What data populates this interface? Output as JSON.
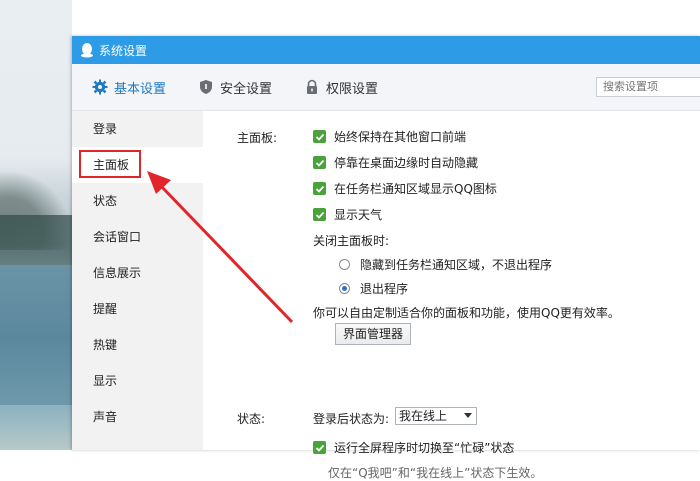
{
  "window": {
    "title": "系统设置"
  },
  "tabs": [
    {
      "label": "基本设置",
      "icon": "gear-icon"
    },
    {
      "label": "安全设置",
      "icon": "shield-icon"
    },
    {
      "label": "权限设置",
      "icon": "lock-icon"
    }
  ],
  "search": {
    "placeholder": "搜索设置项"
  },
  "sidebar": {
    "items": [
      {
        "label": "登录"
      },
      {
        "label": "主面板"
      },
      {
        "label": "状态"
      },
      {
        "label": "会话窗口"
      },
      {
        "label": "信息展示"
      },
      {
        "label": "提醒"
      },
      {
        "label": "热键"
      },
      {
        "label": "显示"
      },
      {
        "label": "声音"
      }
    ]
  },
  "main_panel": {
    "section_label": "主面板:",
    "options": [
      {
        "label": "始终保持在其他窗口前端",
        "checked": true
      },
      {
        "label": "停靠在桌面边缘时自动隐藏",
        "checked": true
      },
      {
        "label": "在任务栏通知区域显示QQ图标",
        "checked": true
      },
      {
        "label": "显示天气",
        "checked": true
      }
    ],
    "close_label": "关闭主面板时:",
    "close_options": [
      {
        "label": "隐藏到任务栏通知区域，不退出程序",
        "selected": false
      },
      {
        "label": "退出程序",
        "selected": true
      }
    ],
    "customize_text": "你可以自由定制适合你的面板和功能，使用QQ更有效率。",
    "manager_button": "界面管理器"
  },
  "status": {
    "section_label": "状态:",
    "after_login_label": "登录后状态为:",
    "after_login_value": "我在线上",
    "busy_option": {
      "label": "运行全屏程序时切换至“忙碌”状态",
      "checked": true
    },
    "note": "仅在“Q我吧”和“我在线上”状态下生效。"
  },
  "colors": {
    "titlebar": "#2e9be6",
    "accent": "#1f79c4",
    "checkbox": "#4aa23a",
    "highlight": "#e2252b"
  }
}
